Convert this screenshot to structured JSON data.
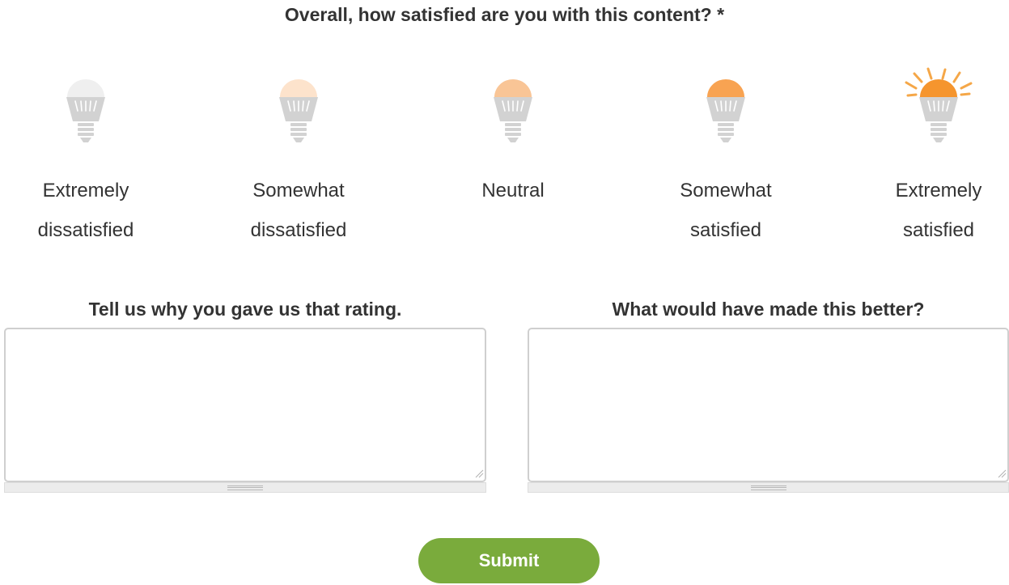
{
  "question": {
    "title": "Overall, how satisfied are you with this content? *"
  },
  "rating": {
    "options": [
      {
        "line1": "Extremely",
        "line2": "dissatisfied",
        "bulb_color": "#efefef",
        "rays": false
      },
      {
        "line1": "Somewhat",
        "line2": "dissatisfied",
        "bulb_color": "#fde3cc",
        "rays": false
      },
      {
        "line1": "Neutral",
        "line2": "",
        "bulb_color": "#f9c596",
        "rays": false
      },
      {
        "line1": "Somewhat",
        "line2": "satisfied",
        "bulb_color": "#f8a352",
        "rays": false
      },
      {
        "line1": "Extremely",
        "line2": "satisfied",
        "bulb_color": "#f5952e",
        "rays": true
      }
    ],
    "base_color": "#d2d2d2",
    "ray_color": "#f5a748"
  },
  "fields": {
    "why": {
      "label": "Tell us why you gave us that rating.",
      "value": "",
      "placeholder": ""
    },
    "better": {
      "label": "What would have made this better?",
      "value": "",
      "placeholder": ""
    }
  },
  "submit": {
    "label": "Submit",
    "color": "#7aab3c"
  }
}
